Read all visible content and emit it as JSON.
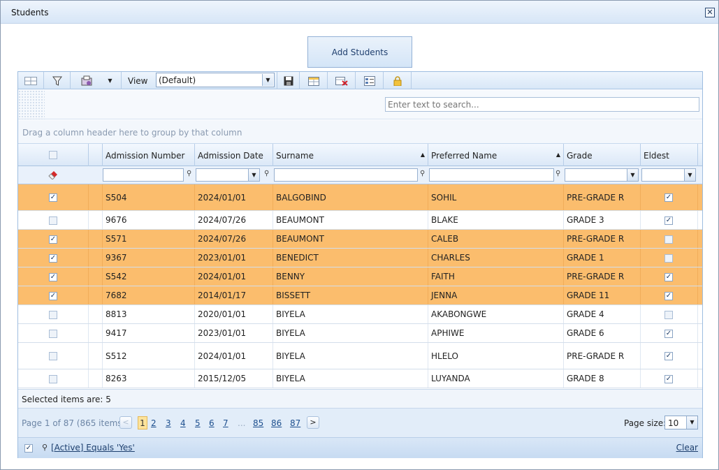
{
  "window": {
    "title": "Students",
    "close_label": "✕"
  },
  "add_button": "Add Students",
  "toolbar": {
    "view_label": "View",
    "view_value": "(Default)"
  },
  "search": {
    "placeholder": "Enter text to search..."
  },
  "group_hint": "Drag a column header here to group by that column",
  "columns": [
    "Admission Number",
    "Admission Date",
    "Surname",
    "Preferred Name",
    "Grade",
    "Eldest"
  ],
  "rows": [
    {
      "selected": true,
      "admission_number": "S504",
      "admission_date": "2024/01/01",
      "surname": "BALGOBIND",
      "preferred_name": "SOHIL",
      "grade": "PRE-GRADE R",
      "eldest": true
    },
    {
      "selected": false,
      "admission_number": "9676",
      "admission_date": "2024/07/26",
      "surname": "BEAUMONT",
      "preferred_name": "BLAKE",
      "grade": "GRADE 3",
      "eldest": true
    },
    {
      "selected": true,
      "admission_number": "S571",
      "admission_date": "2024/07/26",
      "surname": "BEAUMONT",
      "preferred_name": "CALEB",
      "grade": "PRE-GRADE R",
      "eldest": false
    },
    {
      "selected": true,
      "admission_number": "9367",
      "admission_date": "2023/01/01",
      "surname": "BENEDICT",
      "preferred_name": "CHARLES",
      "grade": "GRADE 1",
      "eldest": false
    },
    {
      "selected": true,
      "admission_number": "S542",
      "admission_date": "2024/01/01",
      "surname": "BENNY",
      "preferred_name": "FAITH",
      "grade": "PRE-GRADE R",
      "eldest": true
    },
    {
      "selected": true,
      "admission_number": "7682",
      "admission_date": "2014/01/17",
      "surname": "BISSETT",
      "preferred_name": "JENNA",
      "grade": "GRADE 11",
      "eldest": true
    },
    {
      "selected": false,
      "admission_number": "8813",
      "admission_date": "2020/01/01",
      "surname": "BIYELA",
      "preferred_name": "AKABONGWE",
      "grade": "GRADE 4",
      "eldest": false
    },
    {
      "selected": false,
      "admission_number": "9417",
      "admission_date": "2023/01/01",
      "surname": "BIYELA",
      "preferred_name": "APHIWE",
      "grade": "GRADE 6",
      "eldest": true
    },
    {
      "selected": false,
      "admission_number": "S512",
      "admission_date": "2024/01/01",
      "surname": "BIYELA",
      "preferred_name": "HLELO",
      "grade": "PRE-GRADE R",
      "eldest": true
    },
    {
      "selected": false,
      "admission_number": "8263",
      "admission_date": "2015/12/05",
      "surname": "BIYELA",
      "preferred_name": "LUYANDA",
      "grade": "GRADE 8",
      "eldest": true
    }
  ],
  "selected_text": "Selected items are: 5",
  "pager": {
    "info": "Page 1 of 87 (865 items)",
    "prev": "<",
    "next": ">",
    "pages": [
      "1",
      "2",
      "3",
      "4",
      "5",
      "6",
      "7",
      "...",
      "85",
      "86",
      "87"
    ],
    "current": "1",
    "page_size_label": "Page size:",
    "page_size": "10"
  },
  "filter_bar": {
    "text": "[Active] Equals 'Yes'",
    "clear": "Clear"
  },
  "colors": {
    "selected_row": "#fbbd6d",
    "header_blue": "#dbe8f7"
  }
}
